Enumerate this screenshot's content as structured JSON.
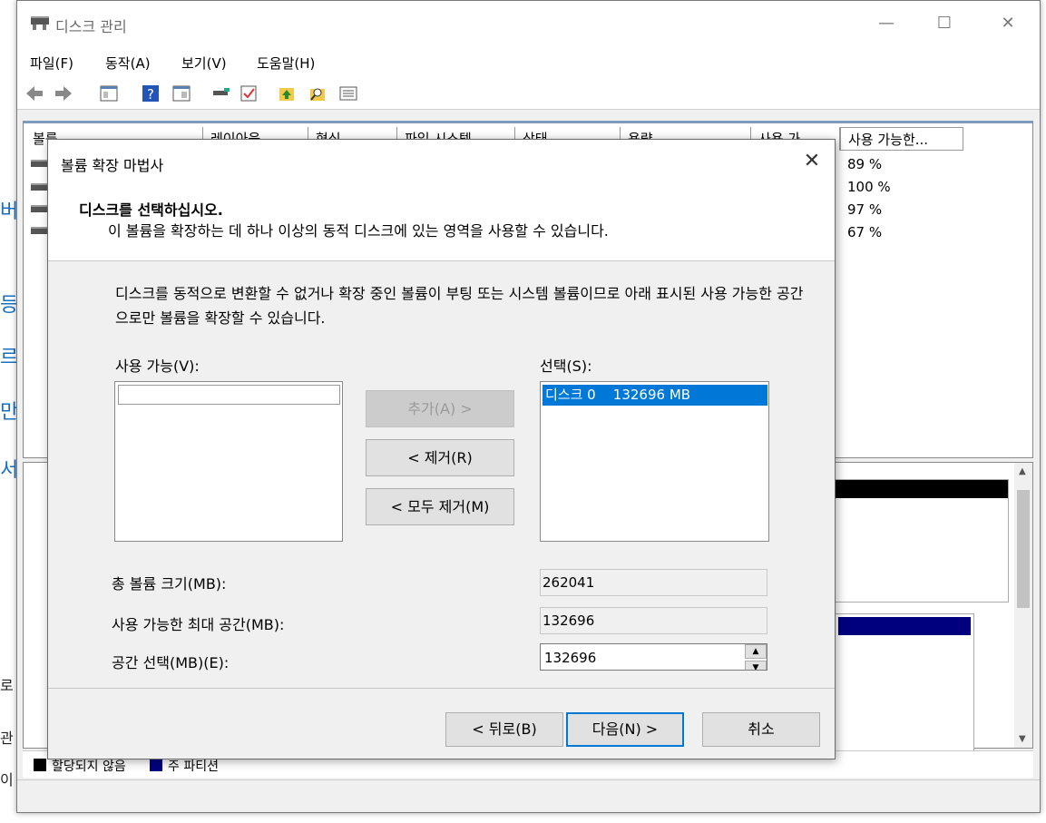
{
  "app": {
    "title": "디스크 관리",
    "menu": [
      "파일(F)",
      "동작(A)",
      "보기(V)",
      "도움말(H)"
    ],
    "win_minimize": "—",
    "win_maximize": "☐",
    "win_close": "✕"
  },
  "volume_list": {
    "columns": [
      "볼륨",
      "레이아웃",
      "형식",
      "파일 시스템",
      "상태",
      "용량",
      "사용 가...",
      "사용 가능한..."
    ],
    "percent_free": [
      "89 %",
      "100 %",
      "97 %",
      "67 %"
    ]
  },
  "legend": {
    "unallocated": "할당되지 않음",
    "primary": "주 파티션"
  },
  "wizard": {
    "title": "볼륨 확장 마법사",
    "close": "✕",
    "header_title": "디스크를 선택하십시오.",
    "header_subtitle": "이 볼륨을 확장하는 데 하나 이상의 동적 디스크에 있는 영역을 사용할 수 있습니다.",
    "description": "디스크를 동적으로 변환할 수 없거나 확장 중인 볼륨이 부팅 또는 시스템 볼륨이므로 아래 표시된 사용 가능한 공간으로만 볼륨을 확장할 수 있습니다.",
    "available_label": "사용 가능(V):",
    "selected_label": "선택(S):",
    "selected_items": [
      "디스크 0    132696 MB"
    ],
    "add_button": "추가(A) >",
    "remove_button": "< 제거(R)",
    "remove_all_button": "< 모두 제거(M)",
    "total_size_label": "총 볼륨 크기(MB):",
    "total_size_value": "262041",
    "max_space_label": "사용 가능한 최대 공간(MB):",
    "max_space_value": "132696",
    "select_space_label": "공간 선택(MB)(E):",
    "select_space_value": "132696",
    "back_button": "< 뒤로(B)",
    "next_button": "다음(N) >",
    "cancel_button": "취소"
  },
  "colors": {
    "accent": "#0078d7",
    "unallocated": "#000000",
    "primary_partition": "#00007f"
  }
}
